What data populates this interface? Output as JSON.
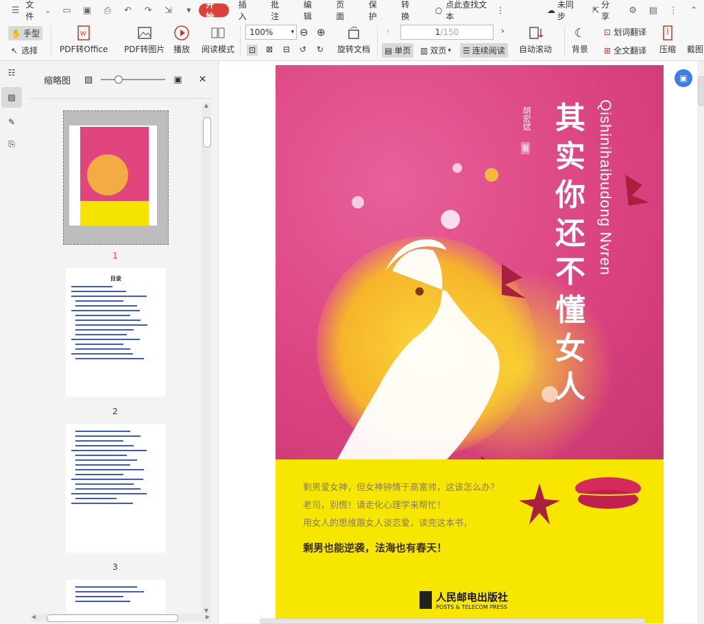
{
  "menubar": {
    "file": "文件",
    "tabs": [
      "开始",
      "插入",
      "批注",
      "编辑",
      "页面",
      "保护",
      "转换"
    ],
    "search": "点此查找文本",
    "sync": "未同步",
    "share": "分享"
  },
  "toolbar": {
    "hand": "手型",
    "select": "选择",
    "pdf_to_office": "PDF转Office",
    "pdf_to_image": "PDF转图片",
    "play": "播放",
    "read_mode": "阅读模式",
    "zoom": "100%",
    "rotate": "旋转文档",
    "page_current": "1",
    "page_total": "/150",
    "single": "单页",
    "double": "双页",
    "continuous": "连续阅读",
    "auto_scroll": "自动滚动",
    "background": "背景",
    "word_translate": "划词翻译",
    "full_translate": "全文翻译",
    "compress": "压缩",
    "crop": "截图"
  },
  "thumbnails": {
    "title": "缩略图",
    "pages": [
      "1",
      "2",
      "3"
    ],
    "toc_title": "目录"
  },
  "book": {
    "title": "其实你还不懂女人",
    "pinyin": "Qishinihaibudong Nvren",
    "author": "胡宏斌",
    "author_suffix": "著",
    "blurb_lines": [
      "剩男爱女神，但女神钟情于高富帅，这该怎么办？",
      "老司，别慌！请走化心理学来帮忙！",
      "用女人的思维跟女人谈恋爱，读完这本书，"
    ],
    "slogan": "剩男也能逆袭，法海也有春天！",
    "publisher": "人民邮电出版社",
    "publisher_en": "POSTS & TELECOM PRESS"
  }
}
